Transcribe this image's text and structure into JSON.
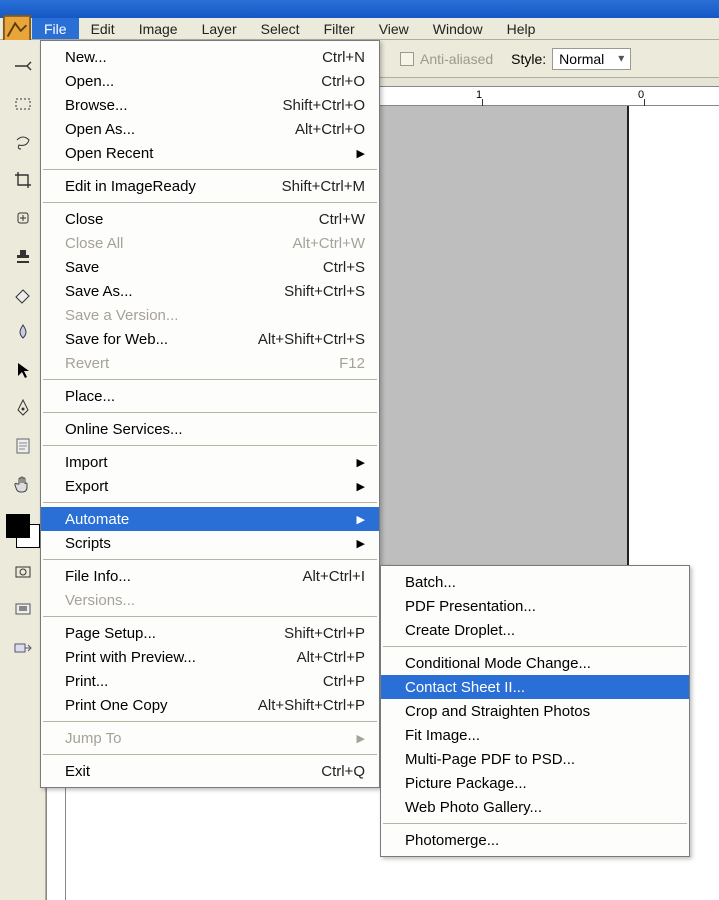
{
  "menubar": {
    "items": [
      "File",
      "Edit",
      "Image",
      "Layer",
      "Select",
      "Filter",
      "View",
      "Window",
      "Help"
    ],
    "active_index": 0
  },
  "options": {
    "antialiased_label": "Anti-aliased",
    "style_label": "Style:",
    "style_value": "Normal"
  },
  "ruler": {
    "label1": "1",
    "label2": "0"
  },
  "file_menu": [
    {
      "label": "New...",
      "shortcut": "Ctrl+N"
    },
    {
      "label": "Open...",
      "shortcut": "Ctrl+O"
    },
    {
      "label": "Browse...",
      "shortcut": "Shift+Ctrl+O"
    },
    {
      "label": "Open As...",
      "shortcut": "Alt+Ctrl+O"
    },
    {
      "label": "Open Recent",
      "submenu": true
    },
    {
      "sep": true
    },
    {
      "label": "Edit in ImageReady",
      "shortcut": "Shift+Ctrl+M"
    },
    {
      "sep": true
    },
    {
      "label": "Close",
      "shortcut": "Ctrl+W"
    },
    {
      "label": "Close All",
      "shortcut": "Alt+Ctrl+W",
      "disabled": true
    },
    {
      "label": "Save",
      "shortcut": "Ctrl+S"
    },
    {
      "label": "Save As...",
      "shortcut": "Shift+Ctrl+S"
    },
    {
      "label": "Save a Version...",
      "disabled": true
    },
    {
      "label": "Save for Web...",
      "shortcut": "Alt+Shift+Ctrl+S"
    },
    {
      "label": "Revert",
      "shortcut": "F12",
      "disabled": true
    },
    {
      "sep": true
    },
    {
      "label": "Place..."
    },
    {
      "sep": true
    },
    {
      "label": "Online Services..."
    },
    {
      "sep": true
    },
    {
      "label": "Import",
      "submenu": true
    },
    {
      "label": "Export",
      "submenu": true
    },
    {
      "sep": true
    },
    {
      "label": "Automate",
      "submenu": true,
      "highlight": true
    },
    {
      "label": "Scripts",
      "submenu": true
    },
    {
      "sep": true
    },
    {
      "label": "File Info...",
      "shortcut": "Alt+Ctrl+I"
    },
    {
      "label": "Versions...",
      "disabled": true
    },
    {
      "sep": true
    },
    {
      "label": "Page Setup...",
      "shortcut": "Shift+Ctrl+P"
    },
    {
      "label": "Print with Preview...",
      "shortcut": "Alt+Ctrl+P"
    },
    {
      "label": "Print...",
      "shortcut": "Ctrl+P"
    },
    {
      "label": "Print One Copy",
      "shortcut": "Alt+Shift+Ctrl+P"
    },
    {
      "sep": true
    },
    {
      "label": "Jump To",
      "submenu": true,
      "disabled": true
    },
    {
      "sep": true
    },
    {
      "label": "Exit",
      "shortcut": "Ctrl+Q"
    }
  ],
  "automate_menu": [
    {
      "label": "Batch..."
    },
    {
      "label": "PDF Presentation..."
    },
    {
      "label": "Create Droplet..."
    },
    {
      "sep": true
    },
    {
      "label": "Conditional Mode Change..."
    },
    {
      "label": "Contact Sheet II...",
      "highlight": true
    },
    {
      "label": "Crop and Straighten Photos"
    },
    {
      "label": "Fit Image..."
    },
    {
      "label": "Multi-Page PDF to PSD..."
    },
    {
      "label": "Picture Package..."
    },
    {
      "label": "Web Photo Gallery..."
    },
    {
      "sep": true
    },
    {
      "label": "Photomerge..."
    }
  ],
  "toolbar_icons": [
    "airbrush-tool",
    "marquee-tool",
    "lasso-tool",
    "crop-tool",
    "healing-tool",
    "stamp-tool",
    "eraser-tool",
    "blur-tool",
    "move-arrow-tool",
    "pen-tool",
    "notes-tool",
    "hand-tool"
  ]
}
